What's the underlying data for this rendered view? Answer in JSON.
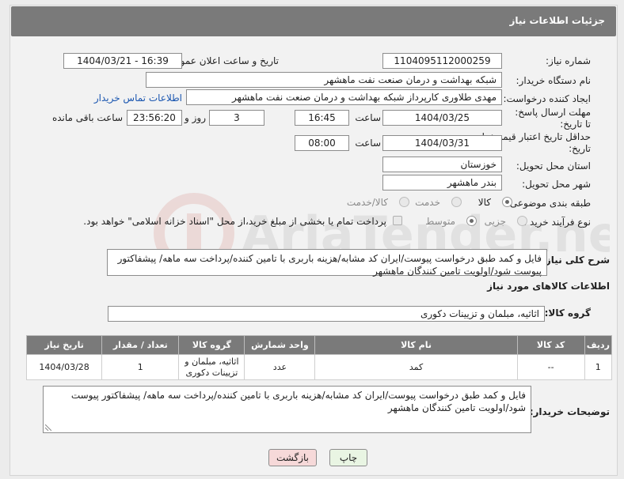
{
  "header": {
    "title": "جزئیات اطلاعات نیاز"
  },
  "fields": {
    "need_number_label": "شماره نیاز:",
    "need_number": "1104095112000259",
    "announce_label": "تاریخ و ساعت اعلان عمومی:",
    "announce_value": "1404/03/21 - 16:39",
    "buyer_org_label": "نام دستگاه خریدار:",
    "buyer_org": "شبکه بهداشت و درمان صنعت نفت ماهشهر",
    "creator_label": "ایجاد کننده درخواست:",
    "creator": "مهدی طلاوری کارپرداز شبکه بهداشت و درمان صنعت نفت ماهشهر",
    "contact_link": "اطلاعات تماس خریدار",
    "send_deadline_label": "مهلت ارسال پاسخ: تا تاریخ:",
    "send_date": "1404/03/25",
    "time_label": "ساعت",
    "send_time": "16:45",
    "days_count": "3",
    "days_label": "روز و",
    "remaining_time": "23:56:20",
    "remaining_label": "ساعت باقی مانده",
    "price_validity_label": "حداقل تاریخ اعتبار قیمت: تا تاریخ:",
    "price_date": "1404/03/31",
    "price_time": "08:00",
    "province_label": "استان محل تحویل:",
    "province": "خوزستان",
    "city_label": "شهر محل تحویل:",
    "city": "بندر ماهشهر",
    "category_label": "طبقه بندی موضوعی:",
    "category_options": [
      "کالا",
      "خدمت",
      "کالا/خدمت"
    ],
    "process_label": "نوع فرآیند خرید :",
    "process_options": [
      "جزیی",
      "متوسط"
    ],
    "payment_note": "پرداخت تمام یا بخشی از مبلغ خرید،از محل \"اسناد خزانه اسلامی\" خواهد بود.",
    "need_desc_label": "شرح کلی نیاز:",
    "need_desc": "فایل و کمد طبق درخواست پیوست/ایران کد مشابه/هزینه باربری با تامین کننده/پرداخت سه ماهه/ پیشفاکتور پیوست شود/اولویت تامین کنندگان ماهشهر"
  },
  "goods": {
    "section_title": "اطلاعات کالاهای مورد نیاز",
    "group_label": "گروه کالا:",
    "group_value": "اثاثیه، مبلمان و تزیینات دکوری",
    "columns": [
      "ردیف",
      "کد کالا",
      "نام کالا",
      "واحد شمارش",
      "گروه کالا",
      "تعداد / مقدار",
      "تاریخ نیاز"
    ],
    "rows": [
      [
        "1",
        "--",
        "کمد",
        "عدد",
        "اثاثیه، مبلمان و تزیینات دکوری",
        "1",
        "1404/03/28"
      ]
    ]
  },
  "buyer_notes": {
    "label": "توضیحات خریدار:",
    "text": "فایل و کمد طبق درخواست پیوست/ایران کد مشابه/هزینه باربری با تامین کننده/پرداخت سه ماهه/ پیشفاکتور پیوست شود/اولویت تامین کنندگان ماهشهر"
  },
  "buttons": {
    "print": "چاپ",
    "back": "بازگشت"
  },
  "watermark": {
    "text": "AriaTender.neT"
  },
  "colors": {
    "header_bg": "#7a7a7a",
    "back_button_bg": "#f6d9d9",
    "print_button_bg": "#e9f5e3",
    "link": "#1a56b0"
  }
}
